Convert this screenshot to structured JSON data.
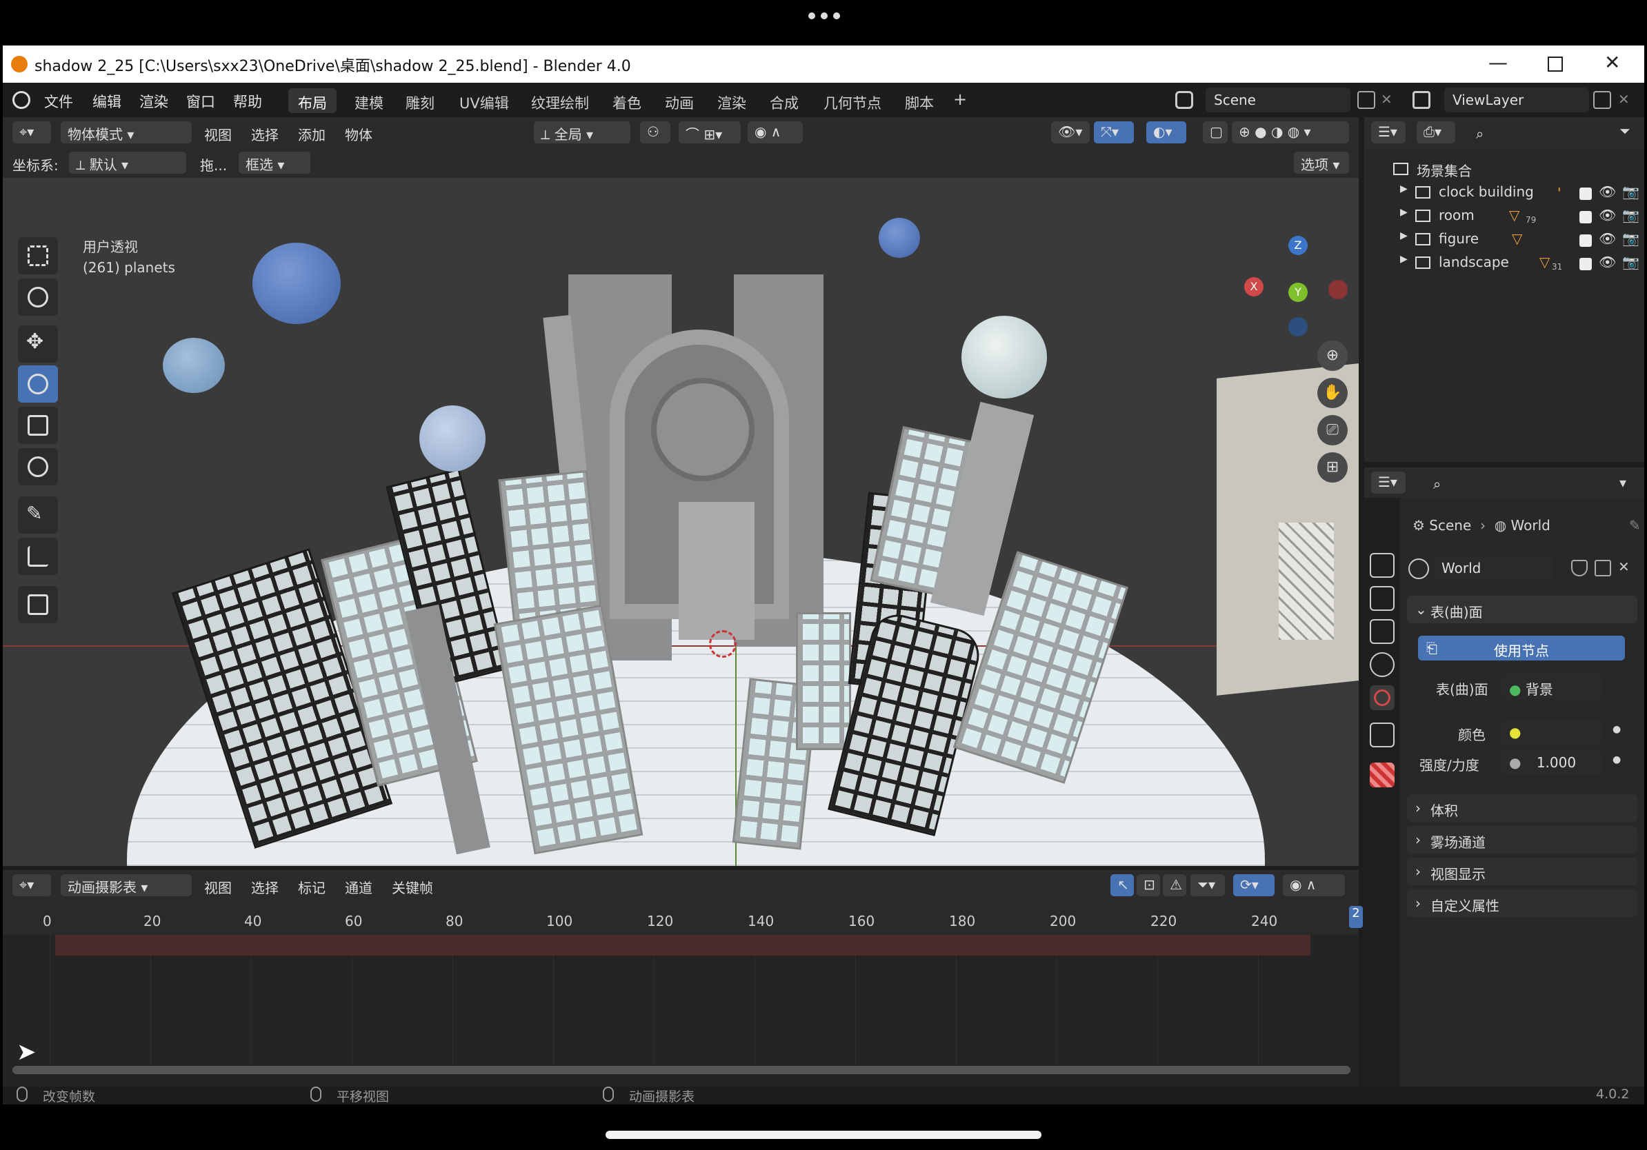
{
  "window": {
    "title": "shadow 2_25 [C:\\Users\\sxx23\\OneDrive\\桌面\\shadow 2_25.blend] - Blender 4.0"
  },
  "menu": [
    "文件",
    "编辑",
    "渲染",
    "窗口",
    "帮助"
  ],
  "workspaces": [
    "布局",
    "建模",
    "雕刻",
    "UV编辑",
    "纹理绘制",
    "着色",
    "动画",
    "渲染",
    "合成",
    "几何节点",
    "脚本"
  ],
  "workspace_add": "+",
  "scene_selector": {
    "label": "Scene"
  },
  "viewlayer_selector": {
    "label": "ViewLayer"
  },
  "viewport_header": {
    "mode": "物体模式",
    "menus": [
      "视图",
      "选择",
      "添加",
      "物体"
    ],
    "transform_orientation": "全局",
    "coord_label": "坐标系:",
    "coord_value": "默认",
    "drag_label": "拖...",
    "select_mode": "框选",
    "options": "选项"
  },
  "viewport_overlay": {
    "view_name": "用户透视",
    "collection_info": "(261) planets"
  },
  "gizmo": {
    "x": "X",
    "y": "Y",
    "z": "Z"
  },
  "outliner": {
    "root": "场景集合",
    "items": [
      {
        "label": "clock building"
      },
      {
        "label": "room",
        "badge": "79"
      },
      {
        "label": "figure"
      },
      {
        "label": "landscape",
        "badge": "31"
      }
    ]
  },
  "properties": {
    "breadcrumb": [
      "Scene",
      "World"
    ],
    "world_name": "World",
    "sections": {
      "surface": "表(曲)面",
      "use_nodes": "使用节点",
      "surface_label": "表(曲)面",
      "surface_value": "背景",
      "color_label": "颜色",
      "strength_label": "强度/力度",
      "strength_value": "1.000",
      "volume": "体积",
      "mist": "雾场通道",
      "viewport_display": "视图显示",
      "custom_props": "自定义属性"
    }
  },
  "timeline_header": {
    "editor": "动画摄影表",
    "menus": [
      "视图",
      "选择",
      "标记",
      "通道",
      "关键帧"
    ]
  },
  "timeline_ticks": [
    "0",
    "20",
    "40",
    "60",
    "80",
    "100",
    "120",
    "140",
    "160",
    "180",
    "200",
    "220",
    "240"
  ],
  "timeline_tick_frames": [
    0,
    20,
    40,
    60,
    80,
    100,
    120,
    140,
    160,
    180,
    200,
    220,
    240
  ],
  "current_frame_partial": "2",
  "status_bar": {
    "left": "改变帧数",
    "middle": "平移视图",
    "right": "动画摄影表",
    "version": "4.0.2"
  },
  "colors": {
    "accent": "#4772b3",
    "planet_blue": "#5a7fbf",
    "outliner_icon_orange": "#e89b3a"
  }
}
